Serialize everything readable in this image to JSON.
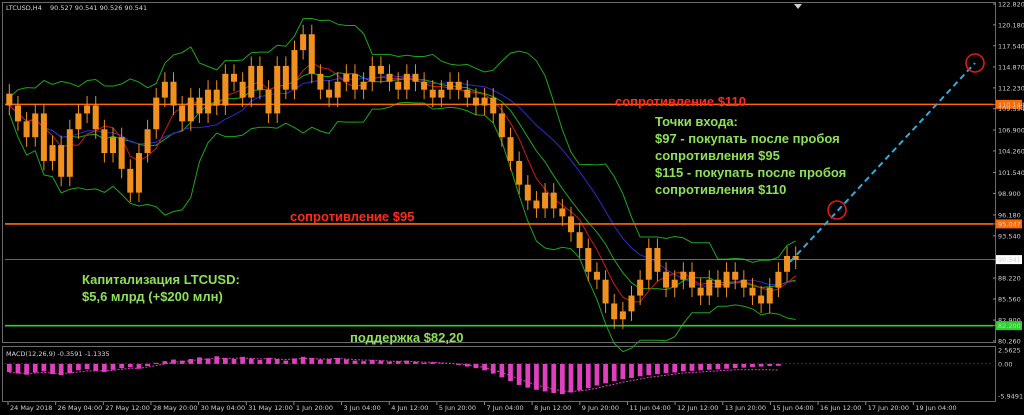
{
  "header": {
    "symbol": "LTCUSD,H4",
    "ohlc": "90.527 90.541 90.526 90.541",
    "macd_label": "MACD(12,26,9) -0.3591 -1.1335"
  },
  "colors": {
    "background": "#000000",
    "candle": "#f0901e",
    "bb_band": "#1aa81a",
    "ma_blue": "#2b2bd8",
    "ma_red": "#d01818",
    "resistance": "#ff6a00",
    "support": "#2cd12c",
    "forecast": "#33aadd",
    "circle": "#e01818",
    "macd_hist": "#e040c0"
  },
  "annotations": {
    "resistance_110": "сопротивление $110",
    "resistance_95": "сопротивление $95",
    "support": "поддержка $82,20",
    "cap_line1": "Капитализация LTCUSD:",
    "cap_line2": "$5,6 млрд (+$200 млн)",
    "entry_title": "Точки входа:",
    "entry_1": "$97 - покупать после пробоя",
    "entry_2": "сопротивления $95",
    "entry_3": "$115 - покупать после пробоя",
    "entry_4": "сопротивления $110"
  },
  "chart_data": {
    "type": "candlestick",
    "symbol": "LTCUSD",
    "timeframe": "H4",
    "y_ticks": [
      "122.820",
      "120.180",
      "117.540",
      "114.870",
      "112.230",
      "110.144",
      "109.594",
      "106.900",
      "104.260",
      "101.540",
      "98.900",
      "96.180",
      "95.047",
      "93.540",
      "90.541",
      "88.220",
      "85.560",
      "82.900",
      "82.200",
      "80.260"
    ],
    "y_tick_values": [
      122.82,
      120.18,
      117.54,
      114.87,
      112.23,
      110.144,
      109.594,
      106.9,
      104.26,
      101.54,
      98.9,
      96.18,
      95.047,
      93.54,
      90.541,
      88.22,
      85.56,
      82.9,
      82.2,
      80.26
    ],
    "ylim": [
      80.26,
      122.82
    ],
    "highlighted_ticks": {
      "110.144": "#ff6a00",
      "95.047": "#ff6a00",
      "82.200": "#2cd12c",
      "90.541": "#ffffff"
    },
    "x_labels": [
      "24 May 2018",
      "26 May 04:00",
      "27 May 12:00",
      "28 May 20:00",
      "30 May 04:00",
      "31 May 12:00",
      "1 Jun 20:00",
      "3 Jun 04:00",
      "4 Jun 12:00",
      "5 Jun 20:00",
      "7 Jun 04:00",
      "8 Jun 12:00",
      "9 Jun 20:00",
      "11 Jun 04:00",
      "12 Jun 12:00",
      "13 Jun 20:00",
      "15 Jun 04:00",
      "16 Jun 12:00",
      "17 Jun 20:00",
      "19 Jun 04:00"
    ],
    "levels": [
      {
        "name": "resistance_110",
        "value": 110.144
      },
      {
        "name": "resistance_95",
        "value": 95.047
      },
      {
        "name": "support",
        "value": 82.2
      },
      {
        "name": "last_price",
        "value": 90.541
      }
    ],
    "closes": [
      110,
      108,
      106,
      109,
      103,
      105,
      101,
      107,
      109,
      110,
      107,
      104,
      106,
      102,
      99,
      104,
      107,
      111,
      113,
      110,
      108,
      111,
      109,
      112,
      110,
      114,
      113,
      111,
      115,
      112,
      109,
      115,
      112,
      117,
      119,
      114,
      112,
      111,
      113,
      114,
      112,
      113,
      115,
      114,
      113,
      112,
      114,
      113,
      112,
      111,
      112,
      113,
      112,
      111,
      110,
      111,
      109,
      106,
      103,
      100,
      98,
      97,
      99,
      97,
      96,
      94,
      92,
      89,
      88,
      85,
      83,
      84,
      86,
      88,
      92,
      89,
      87,
      88,
      89,
      87,
      86,
      88,
      87,
      89,
      88,
      87,
      86,
      85,
      87,
      89,
      91,
      90.54
    ],
    "macd": {
      "ylim": [
        -6.5,
        2.5625
      ],
      "y_ticks": [
        "2.5625",
        "0.00",
        "-5.9491"
      ],
      "y_tick_values": [
        2.5625,
        0,
        -5.9491
      ],
      "hist": [
        -1.5,
        -1.8,
        -2.0,
        -1.6,
        -1.4,
        -1.9,
        -2.1,
        -1.7,
        -1.2,
        -1.0,
        -1.3,
        -1.5,
        -1.1,
        -0.8,
        -0.6,
        -0.9,
        -0.4,
        0.2,
        0.5,
        0.8,
        0.6,
        0.9,
        1.2,
        1.0,
        1.4,
        1.1,
        0.9,
        1.3,
        1.0,
        0.7,
        1.1,
        0.9,
        0.6,
        1.0,
        1.3,
        1.1,
        0.8,
        0.9,
        1.1,
        0.8,
        0.6,
        0.5,
        0.7,
        0.6,
        0.4,
        0.5,
        0.6,
        0.4,
        0.2,
        0.3,
        0.1,
        0.0,
        -0.2,
        -0.5,
        -0.8,
        -1.2,
        -1.8,
        -2.5,
        -3.2,
        -3.9,
        -4.4,
        -4.8,
        -5.1,
        -5.4,
        -5.6,
        -5.3,
        -4.9,
        -4.5,
        -4.0,
        -3.6,
        -3.2,
        -2.8,
        -2.6,
        -2.3,
        -2.1,
        -1.9,
        -1.7,
        -1.6,
        -1.4,
        -1.3,
        -1.2,
        -1.1,
        -1.0,
        -0.9,
        -0.8,
        -0.7,
        -0.6,
        -0.5,
        -0.4,
        -0.36
      ],
      "signal": [
        -1.6,
        -1.7,
        -1.8,
        -1.7,
        -1.6,
        -1.7,
        -1.8,
        -1.7,
        -1.5,
        -1.3,
        -1.3,
        -1.3,
        -1.2,
        -1.0,
        -0.8,
        -0.8,
        -0.6,
        -0.3,
        0.0,
        0.3,
        0.4,
        0.6,
        0.8,
        0.9,
        1.0,
        1.0,
        1.0,
        1.1,
        1.0,
        0.9,
        1.0,
        0.9,
        0.8,
        0.9,
        1.0,
        1.0,
        0.9,
        0.9,
        1.0,
        0.9,
        0.8,
        0.7,
        0.7,
        0.6,
        0.5,
        0.5,
        0.5,
        0.4,
        0.3,
        0.3,
        0.2,
        0.1,
        0.0,
        -0.2,
        -0.4,
        -0.7,
        -1.1,
        -1.6,
        -2.2,
        -2.8,
        -3.4,
        -3.9,
        -4.3,
        -4.7,
        -5.0,
        -5.1,
        -5.0,
        -4.8,
        -4.5,
        -4.1,
        -3.8,
        -3.4,
        -3.1,
        -2.8,
        -2.5,
        -2.3,
        -2.1,
        -1.9,
        -1.7,
        -1.6,
        -1.5,
        -1.4,
        -1.3,
        -1.2,
        -1.1,
        -1.1,
        -1.1,
        -1.1,
        -1.1,
        -1.13
      ]
    }
  }
}
